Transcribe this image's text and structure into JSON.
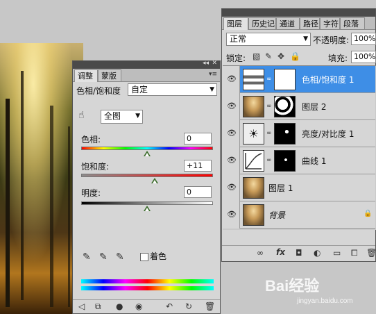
{
  "adjustments_panel": {
    "tabs": [
      "调整",
      "蒙版"
    ],
    "preset_label": "色相/饱和度",
    "preset_value": "自定",
    "edit_range": "全图",
    "hue_label": "色相:",
    "hue_value": "0",
    "saturation_label": "饱和度:",
    "saturation_value": "+11",
    "lightness_label": "明度:",
    "lightness_value": "0",
    "colorize_label": "着色",
    "hue_slider_level": 0.5,
    "saturation_slider_level": 0.555,
    "lightness_slider_level": 0.5
  },
  "layers_panel": {
    "tabs": [
      "图层",
      "历史记录",
      "通道",
      "路径",
      "字符",
      "段落"
    ],
    "blend_mode": "正常",
    "opacity_label": "不透明度:",
    "opacity_value": "100%",
    "lock_label": "锁定:",
    "fill_label": "填充:",
    "fill_value": "100%",
    "layers": [
      {
        "name": "色相/饱和度 1",
        "selected": true
      },
      {
        "name": "图层 2",
        "selected": false
      },
      {
        "name": "亮度/对比度 1",
        "selected": false
      },
      {
        "name": "曲线 1",
        "selected": false
      },
      {
        "name": "图层 1",
        "selected": false
      },
      {
        "name": "背景",
        "selected": false
      }
    ]
  },
  "watermark": {
    "brand": "Bai经验",
    "url": "jingyan.baidu.com"
  }
}
